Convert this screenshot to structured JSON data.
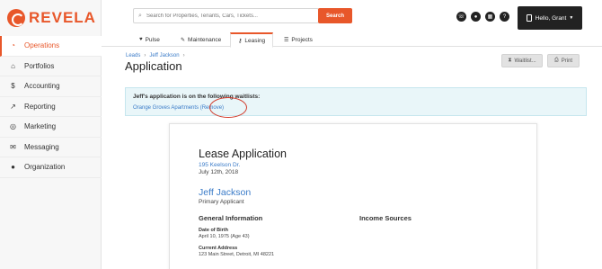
{
  "brand": {
    "name": "REVELA",
    "color": "#e8572a"
  },
  "sidebar": {
    "items": [
      {
        "label": "Operations",
        "icon": "gauge-icon",
        "active": true
      },
      {
        "label": "Portfolios",
        "icon": "home-icon"
      },
      {
        "label": "Accounting",
        "icon": "dollar-icon"
      },
      {
        "label": "Reporting",
        "icon": "line-chart-icon"
      },
      {
        "label": "Marketing",
        "icon": "target-icon"
      },
      {
        "label": "Messaging",
        "icon": "envelope-icon"
      },
      {
        "label": "Organization",
        "icon": "users-icon"
      }
    ]
  },
  "topbar": {
    "search_placeholder": "Search for Properties, Tenants, Cars, Tickets...",
    "search_button": "Search",
    "user_label": "Hello, Grant"
  },
  "tabs": [
    {
      "label": "Pulse",
      "icon": "heart-icon"
    },
    {
      "label": "Maintenance",
      "icon": "wrench-icon"
    },
    {
      "label": "Leasing",
      "icon": "key-icon",
      "active": true
    },
    {
      "label": "Projects",
      "icon": "list-icon"
    }
  ],
  "breadcrumb": {
    "items": [
      "Leads",
      "Jeff Jackson"
    ]
  },
  "page": {
    "title": "Application",
    "waitlist_button": "Waitlist...",
    "print_button": "Print"
  },
  "alert": {
    "heading": "Jeff's application is on the following waitlists:",
    "property": "Orange Groves Apartments",
    "remove_link": "(Remove)"
  },
  "document": {
    "title": "Lease Application",
    "address": "195 Keelson Dr.",
    "date": "July 12th, 2018",
    "applicant_name": "Jeff Jackson",
    "applicant_role": "Primary Applicant",
    "general_heading": "General Information",
    "income_heading": "Income Sources",
    "dob_label": "Date of Birth",
    "dob_value": "April 10, 1975 (Age 43)",
    "address_label": "Current Address",
    "address_value": "123 Main Street, Detroit, MI 48221"
  }
}
